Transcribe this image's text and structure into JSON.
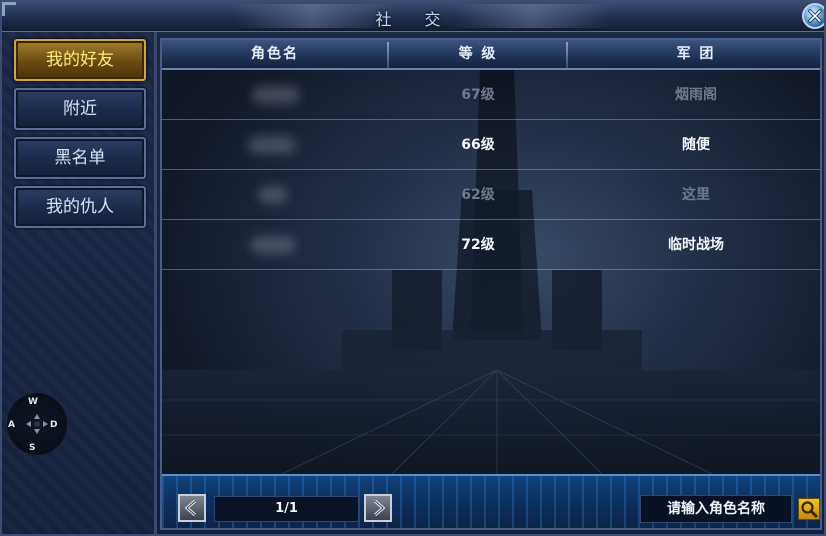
{
  "window": {
    "title": "社 交"
  },
  "sidebar": {
    "items": [
      {
        "label": "我的好友",
        "active": true
      },
      {
        "label": "附近",
        "active": false
      },
      {
        "label": "黑名单",
        "active": false
      },
      {
        "label": "我的仇人",
        "active": false
      }
    ]
  },
  "compass": {
    "north": "W",
    "west": "A",
    "east": "D",
    "south": "S"
  },
  "table": {
    "columns": [
      "角色名",
      "等 级",
      "军 团"
    ],
    "rows": [
      {
        "name": "",
        "level": "67级",
        "legion": "烟雨阁",
        "online": false
      },
      {
        "name": "",
        "level": "66级",
        "legion": "随便",
        "online": true
      },
      {
        "name": "",
        "level": "62级",
        "legion": "这里",
        "online": false
      },
      {
        "name": "",
        "level": "72级",
        "legion": "临时战场",
        "online": true
      }
    ]
  },
  "pager": {
    "page": "1/1"
  },
  "search": {
    "placeholder": "请输入角色名称"
  },
  "icons": {
    "close": "close-icon",
    "prev": "arrow-left-icon",
    "next": "arrow-right-icon",
    "search": "magnifier-icon"
  },
  "colors": {
    "active_tab": "#a57f2b",
    "active_text": "#ffe97a",
    "offline_text": "#6f7a8c",
    "online_text": "#f4f6fa",
    "search_button": "#f1c22e"
  }
}
